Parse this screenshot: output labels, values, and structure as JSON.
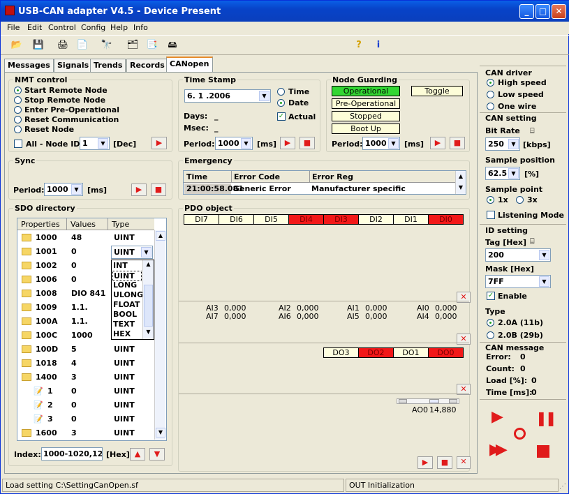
{
  "window": {
    "title": "USB-CAN adapter  V4.5  -  Device Present"
  },
  "menu": [
    "File",
    "Edit",
    "Control",
    "Config",
    "Help",
    "Info"
  ],
  "tabs": [
    "Messages",
    "Signals",
    "Trends",
    "Records",
    "CANopen"
  ],
  "nmt": {
    "title": "NMT control",
    "options": [
      "Start Remote Node",
      "Stop Remote Node",
      "Enter Pre-Operational",
      "Reset Communication",
      "Reset Node"
    ],
    "all_label": "All - Node ID",
    "node_id": "1",
    "unit": "[Dec]"
  },
  "timestamp": {
    "title": "Time Stamp",
    "date": "6. 1 .2006",
    "opt_time": "Time",
    "opt_date": "Date",
    "days_label": "Days:",
    "days_value": "_",
    "msec_label": "Msec:",
    "msec_value": "_",
    "actual_label": "Actual",
    "period_label": "Period:",
    "period_value": "1000",
    "unit": "[ms]"
  },
  "node_guarding": {
    "title": "Node Guarding",
    "states": [
      "Operational",
      "Pre-Operational",
      "Stopped",
      "Boot Up"
    ],
    "toggle": "Toggle",
    "period_label": "Period:",
    "period_value": "1000",
    "unit": "[ms]"
  },
  "sync": {
    "title": "Sync",
    "period_label": "Period:",
    "period_value": "1000",
    "unit": "[ms]"
  },
  "emergency": {
    "title": "Emergency",
    "headers": [
      "Time",
      "Error Code",
      "Error Reg"
    ],
    "row": [
      "21:00:58.081",
      "Generic Error",
      "Manufacturer specific"
    ]
  },
  "sdo": {
    "title": "SDO directory",
    "headers": [
      "Properties",
      "Values",
      "Type"
    ],
    "rows": [
      {
        "p": "1000",
        "v": "48",
        "t": "UINT"
      },
      {
        "p": "1001",
        "v": "0",
        "t": "UINT"
      },
      {
        "p": "1002",
        "v": "0",
        "t": ""
      },
      {
        "p": "1006",
        "v": "0",
        "t": ""
      },
      {
        "p": "1008",
        "v": "DIO 841",
        "t": ""
      },
      {
        "p": "1009",
        "v": "1.1.",
        "t": ""
      },
      {
        "p": "100A",
        "v": "1.1.",
        "t": ""
      },
      {
        "p": "100C",
        "v": "1000",
        "t": ""
      },
      {
        "p": "100D",
        "v": "5",
        "t": "UINT"
      },
      {
        "p": "1018",
        "v": "4",
        "t": "UINT"
      },
      {
        "p": "1400",
        "v": "3",
        "t": "UINT"
      },
      {
        "p": "1",
        "v": "0",
        "t": "UINT"
      },
      {
        "p": "2",
        "v": "0",
        "t": "UINT"
      },
      {
        "p": "3",
        "v": "0",
        "t": "UINT"
      },
      {
        "p": "1600",
        "v": "3",
        "t": "UINT"
      }
    ],
    "dropdown_value": "UINT",
    "dropdown_options": [
      "INT",
      "UINT",
      "LONG",
      "ULONG",
      "FLOAT",
      "BOOL",
      "TEXT",
      "HEX"
    ],
    "index_label": "Index:",
    "index_value": "1000-1020,1200-",
    "index_unit": "[Hex]"
  },
  "pdo": {
    "title": "PDO object",
    "di": [
      {
        "label": "DI7",
        "on": false
      },
      {
        "label": "DI6",
        "on": false
      },
      {
        "label": "DI5",
        "on": false
      },
      {
        "label": "DI4",
        "on": true
      },
      {
        "label": "DI3",
        "on": true
      },
      {
        "label": "DI2",
        "on": false
      },
      {
        "label": "DI1",
        "on": false
      },
      {
        "label": "DI0",
        "on": true
      }
    ],
    "ai": [
      {
        "label": "AI3",
        "value": "0,000"
      },
      {
        "label": "AI2",
        "value": "0,000"
      },
      {
        "label": "AI1",
        "value": "0,000"
      },
      {
        "label": "AI0",
        "value": "0,000"
      },
      {
        "label": "AI7",
        "value": "0,000"
      },
      {
        "label": "AI6",
        "value": "0,000"
      },
      {
        "label": "AI5",
        "value": "0,000"
      },
      {
        "label": "AI4",
        "value": "0,000"
      }
    ],
    "do": [
      {
        "label": "DO3",
        "on": false
      },
      {
        "label": "DO2",
        "on": true
      },
      {
        "label": "DO1",
        "on": false
      },
      {
        "label": "DO0",
        "on": true
      }
    ],
    "ao_label": "AO0",
    "ao_value": "14,880"
  },
  "can_driver": {
    "title": "CAN driver",
    "options": [
      "High speed",
      "Low speed",
      "One wire"
    ]
  },
  "can_setting": {
    "title": "CAN setting",
    "bitrate_label": "Bit Rate",
    "bitrate": "250",
    "bitrate_unit": "[kbps]",
    "sample_pos_label": "Sample position",
    "sample_pos": "62.5",
    "sample_pos_unit": "[%]",
    "sample_point_label": "Sample point",
    "sp_1x": "1x",
    "sp_3x": "3x",
    "listening": "Listening Mode"
  },
  "id_setting": {
    "title": "ID setting",
    "tag_label": "Tag [Hex]",
    "tag": "200",
    "mask_label": "Mask [Hex]",
    "mask": "7FF",
    "enable": "Enable",
    "type_label": "Type",
    "type_a": "2.0A (11b)",
    "type_b": "2.0B (29b)"
  },
  "can_message": {
    "title": "CAN message",
    "error_label": "Error:",
    "error": "0",
    "count_label": "Count:",
    "count": "0",
    "load_label": "Load [%]:",
    "load": "0",
    "time_label": "Time [ms]:",
    "time": "0"
  },
  "status": {
    "left": "Load setting C:\\SettingCanOpen.sf",
    "right": "OUT Initialization"
  },
  "colors": {
    "title_bar": "#0a5fe6",
    "on_red": "#f21818",
    "operational_green": "#33d633",
    "pill_yellow": "#fdfdd8"
  }
}
